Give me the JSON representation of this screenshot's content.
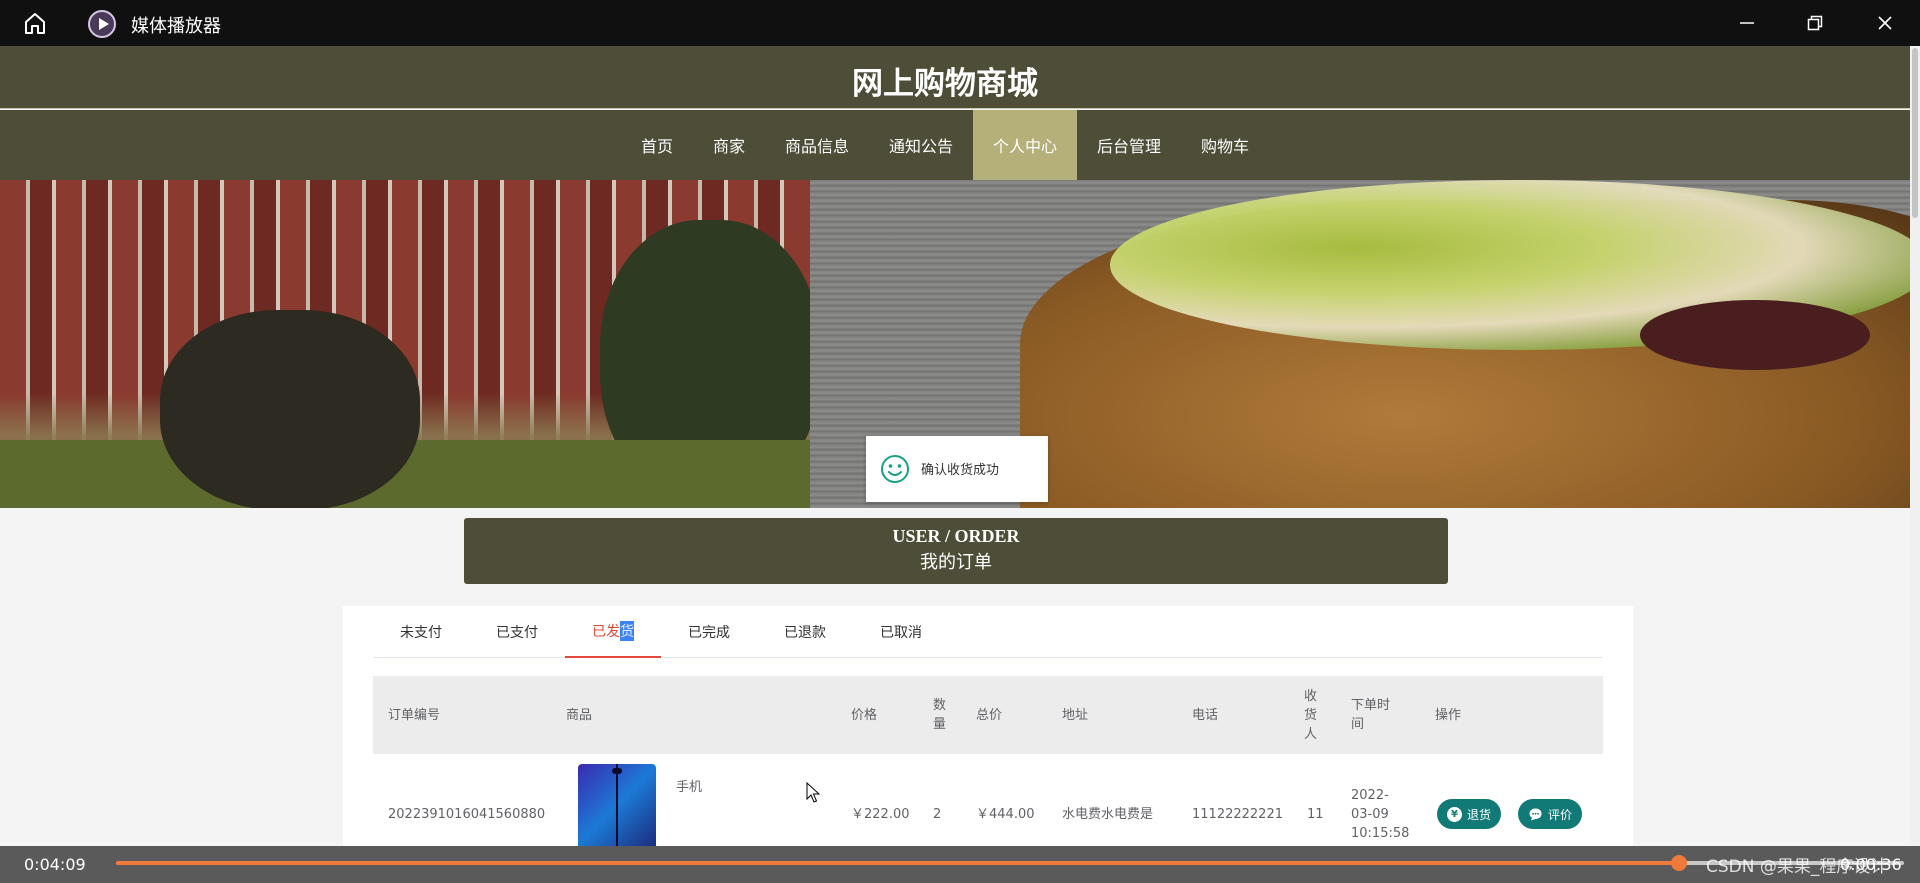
{
  "player": {
    "app_title": "媒体播放器",
    "elapsed": "0:04:09",
    "remaining": "0:00:36",
    "progress": 0.874,
    "accent_color": "#f07a3a",
    "watermark": "CSDN @果果_程序设计"
  },
  "site": {
    "title": "网上购物商城",
    "nav": [
      "首页",
      "商家",
      "商品信息",
      "通知公告",
      "个人中心",
      "后台管理",
      "购物车"
    ],
    "active_nav": "个人中心",
    "header_color": "#4d4d38",
    "active_color": "#b5b07a"
  },
  "toast": {
    "message": "确认收货成功",
    "icon": "smile-icon"
  },
  "section": {
    "title_en": "USER / ORDER",
    "title_cn": "我的订单"
  },
  "tabs": {
    "items": [
      "未支付",
      "已支付",
      "已发货",
      "已完成",
      "已退款",
      "已取消"
    ],
    "active_label": {
      "before": "已发",
      "selected": "货"
    }
  },
  "table": {
    "headers": {
      "order_no": "订单编号",
      "product": "商品",
      "price": "价格",
      "qty": [
        "数",
        "量"
      ],
      "total": "总价",
      "address": "地址",
      "phone": "电话",
      "receiver": [
        "收",
        "货",
        "人"
      ],
      "order_time": [
        "下单时",
        "间"
      ],
      "actions": "操作"
    },
    "rows": [
      {
        "order_no": "2022391016041560880",
        "product_name": "手机",
        "price": "￥222.00",
        "qty": "2",
        "total": "￥444.00",
        "address": "水电费水电费是",
        "phone": "11122222221",
        "receiver": "11",
        "order_time": [
          "2022-",
          "03-09",
          "10:15:58"
        ],
        "actions": {
          "refund": "退货",
          "review": "评价"
        }
      }
    ]
  }
}
